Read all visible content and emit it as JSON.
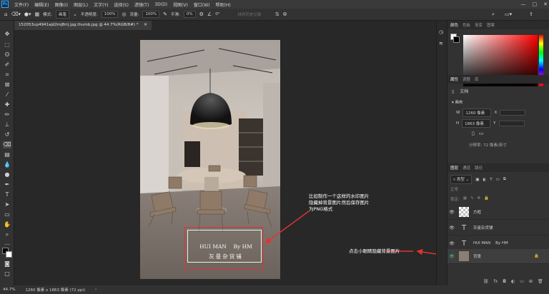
{
  "menubar": {
    "logo": "Ps",
    "items": [
      "文件(F)",
      "编辑(E)",
      "图像(I)",
      "图层(L)",
      "文字(Y)",
      "选择(S)",
      "滤镜(T)",
      "3D(D)",
      "视图(V)",
      "窗口(W)",
      "帮助(H)"
    ],
    "window_controls": [
      "—",
      "□",
      "✕"
    ]
  },
  "options": {
    "mode_label": "模式:",
    "mode_value": "画笔",
    "opacity_label": "不透明度:",
    "opacity_value": "100%",
    "flow_label": "流量:",
    "flow_value": "100%",
    "smooth_label": "平滑:",
    "smooth_value": "0%",
    "angle_value": "0°",
    "history_label": "抹到历史记录"
  },
  "document": {
    "tab_title": "152053up4941ajd2mj8rrj.jpg.thumb.jpg @ 44.7%(RGB/8#) *"
  },
  "watermark": {
    "line1": "HUI MAN    By HM",
    "line2": "灰曼杂货铺"
  },
  "annotations": {
    "note1": [
      "比如制作一个这样的水印图片",
      "隐藏掉背景图片然后保存图片",
      "为PNG格式"
    ],
    "note2": "点击小眼睛隐藏背景图片",
    "color": "#e23232"
  },
  "status": {
    "zoom": "44.7%",
    "size": "1260 像素 x 1863 像素 (72 ppi)"
  },
  "panels": {
    "color_tabs": [
      "颜色",
      "色板",
      "渐变",
      "图案"
    ],
    "properties_tabs": [
      "属性",
      "调整",
      "库"
    ],
    "doc_label": "文档",
    "canvas_label": "画布",
    "w_label": "W",
    "w_value": "1260 像素",
    "h_label": "H",
    "h_value": "1863 像素",
    "x_label": "X",
    "y_label": "Y",
    "resolution": "分辨率: 72 像素/英寸",
    "layers_tabs": [
      "图层",
      "通道",
      "路径"
    ],
    "filter_label": "类型",
    "blend_mode": "正常",
    "lock_label": "锁定:",
    "layers": [
      {
        "name": "方框",
        "type": "shape"
      },
      {
        "name": "灰曼杂货铺",
        "type": "text"
      },
      {
        "name": "HUI MAN    By HM",
        "type": "text"
      },
      {
        "name": "背景",
        "type": "image"
      }
    ]
  }
}
